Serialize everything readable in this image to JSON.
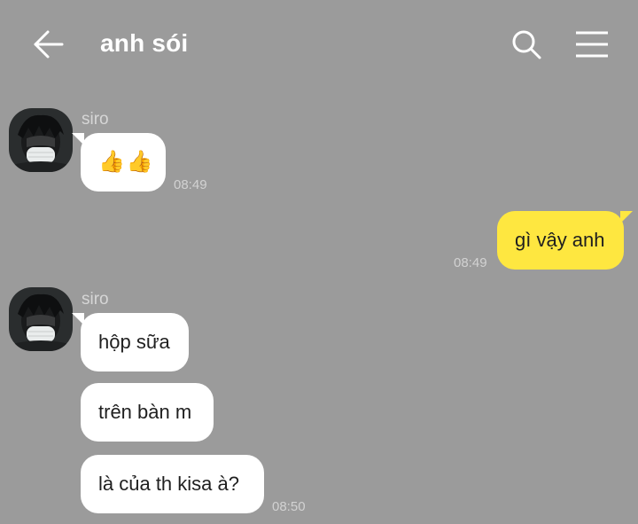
{
  "header": {
    "title": "anh sói",
    "back_icon": "arrow-left-icon",
    "search_icon": "search-icon",
    "menu_icon": "hamburger-menu-icon"
  },
  "messages": [
    {
      "sender": "siro",
      "side": "left",
      "bubbles": [
        "👍👍"
      ],
      "time": "08:49"
    },
    {
      "side": "right",
      "bubbles": [
        "gì vậy anh"
      ],
      "time": "08:49"
    },
    {
      "sender": "siro",
      "side": "left",
      "bubbles": [
        "hộp sữa",
        "trên bàn m",
        "là của th kisa à?"
      ],
      "time": "08:50"
    }
  ],
  "colors": {
    "background": "#9b9b9b",
    "incoming_bubble": "#ffffff",
    "outgoing_bubble": "#fee740"
  }
}
